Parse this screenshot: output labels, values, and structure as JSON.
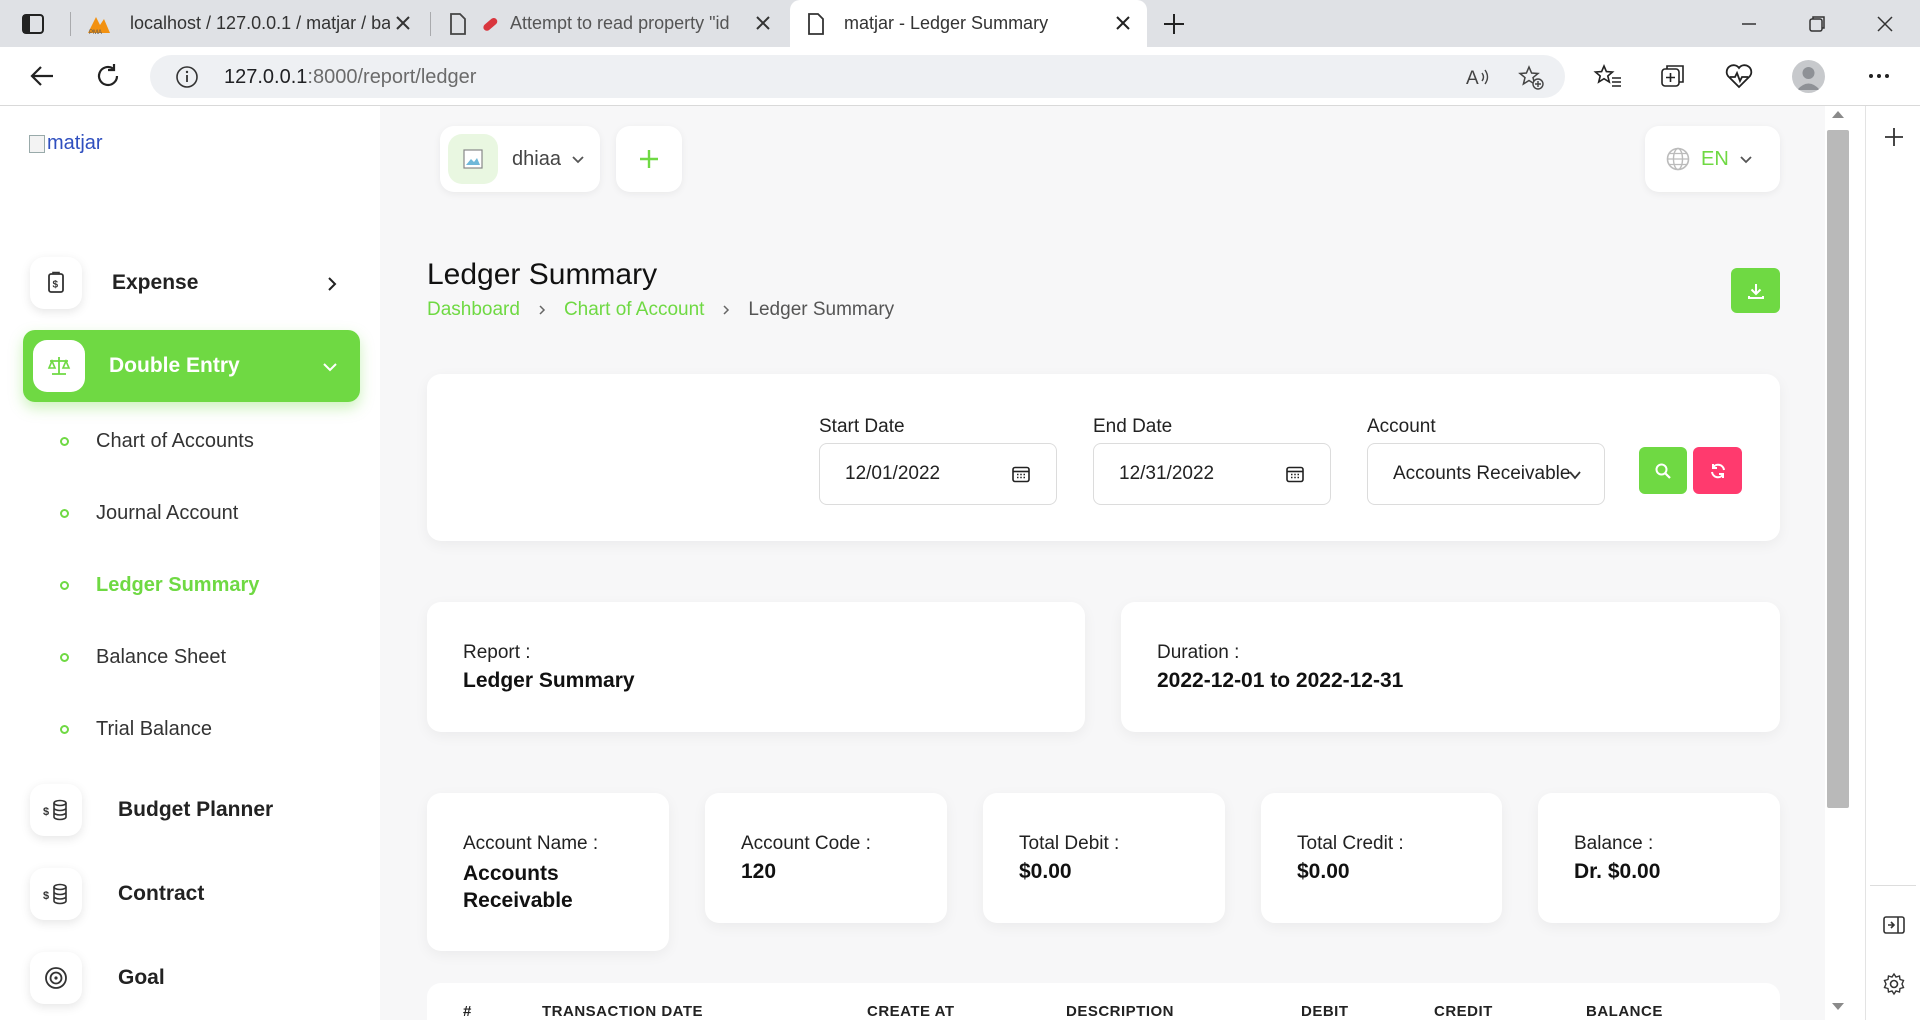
{
  "browser": {
    "tabs": [
      {
        "title": "localhost / 127.0.0.1 / matjar / ba",
        "icon": "phpmyadmin-icon"
      },
      {
        "title": "Attempt to read property \"id",
        "icon": "document-icon"
      },
      {
        "title": "matjar - Ledger Summary",
        "icon": "document-icon"
      }
    ],
    "url_host": "127.0.0.1",
    "url_path": ":8000/report/ledger"
  },
  "sidebar": {
    "logo_alt": "matjar",
    "items": [
      {
        "label": "Expense",
        "icon": "receipt-icon"
      },
      {
        "label": "Double Entry",
        "icon": "scale-icon"
      }
    ],
    "sub_items": [
      {
        "label": "Chart of Accounts"
      },
      {
        "label": "Journal Account"
      },
      {
        "label": "Ledger Summary"
      },
      {
        "label": "Balance Sheet"
      },
      {
        "label": "Trial Balance"
      }
    ],
    "items_after": [
      {
        "label": "Budget Planner",
        "icon": "coins-icon"
      },
      {
        "label": "Contract",
        "icon": "coins-icon"
      },
      {
        "label": "Goal",
        "icon": "target-icon"
      }
    ]
  },
  "header": {
    "user_name": "dhiaa",
    "language": "EN"
  },
  "page": {
    "title": "Ledger Summary",
    "breadcrumb": [
      "Dashboard",
      "Chart of Account",
      "Ledger Summary"
    ]
  },
  "filters": {
    "start_date_label": "Start Date",
    "start_date_value": "12/01/2022",
    "end_date_label": "End Date",
    "end_date_value": "12/31/2022",
    "account_label": "Account",
    "account_value": "Accounts Receivable"
  },
  "report_info": {
    "report_label": "Report :",
    "report_value": "Ledger Summary",
    "duration_label": "Duration :",
    "duration_value": "2022-12-01 to 2022-12-31"
  },
  "summary": [
    {
      "label": "Account Name :",
      "value": "Accounts Receivable"
    },
    {
      "label": "Account Code :",
      "value": "120"
    },
    {
      "label": "Total Debit :",
      "value": "$0.00"
    },
    {
      "label": "Total Credit :",
      "value": "$0.00"
    },
    {
      "label": "Balance :",
      "value": "Dr. $0.00"
    }
  ],
  "table": {
    "columns": [
      "#",
      "TRANSACTION DATE",
      "CREATE AT",
      "DESCRIPTION",
      "DEBIT",
      "CREDIT",
      "BALANCE"
    ]
  },
  "colors": {
    "accent": "#6fd943",
    "danger": "#ff3a6e"
  }
}
